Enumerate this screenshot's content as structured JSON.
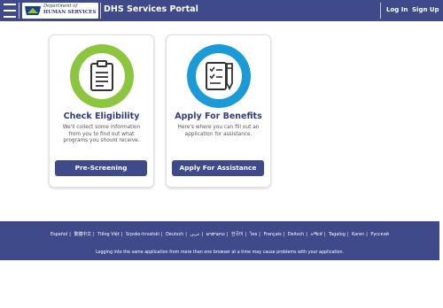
{
  "header": {
    "logo_line1": "Department of",
    "logo_line2": "HUMAN SERVICES",
    "title": "DHS Services Portal",
    "login_label": "Log In",
    "signup_label": "Sign Up"
  },
  "cards": [
    {
      "icon": "clipboard-icon",
      "accent": "#8cc63f",
      "title": "Check Eligibility",
      "description": "We'll collect some information from you to find out what programs you should receive.",
      "button_label": "Pre-Screening"
    },
    {
      "icon": "form-pen-icon",
      "accent": "#1a9ad6",
      "title": "Apply For Benefits",
      "description": "Here's where you can fill out an application for assistance.",
      "button_label": "Apply For Assistance"
    }
  ],
  "footer": {
    "languages": [
      "Español",
      "繁體中文",
      "Tiếng Việt",
      "Srpsko-hrvatski",
      "Deutsch",
      "عربي",
      "ພາສາລາວ",
      "한국어",
      "ไทย",
      "Français",
      "Deitsch",
      "አማርኛ",
      "Tagalog",
      "Karen",
      "Русский"
    ],
    "note": "Logging into the same application from more than one browser at a time may cause problems with your application."
  },
  "colors": {
    "header_bg": "#3e4a8a",
    "eligibility_ring": "#8cc63f",
    "benefits_ring": "#1a9ad6",
    "button_bg": "#3e4a8a",
    "card_title": "#2f3c7e"
  }
}
